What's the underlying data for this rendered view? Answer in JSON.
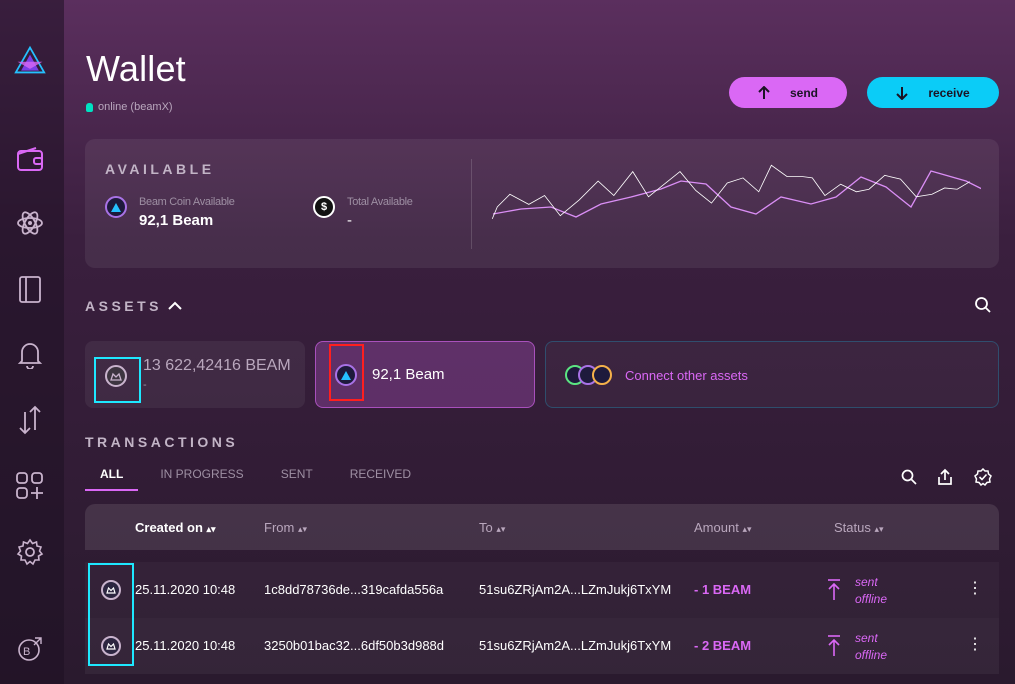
{
  "header": {
    "title": "Wallet",
    "status": "online (beamX)"
  },
  "actions": {
    "send": "send",
    "receive": "receive"
  },
  "available": {
    "label": "AVAILABLE",
    "beam_label": "Beam Coin Available",
    "beam_value": "92,1 Beam",
    "total_label": "Total Available",
    "total_value": "-",
    "total_icon": "$"
  },
  "assets": {
    "label": "ASSETS",
    "items": [
      {
        "value": "13 622,42416 BEAM",
        "sub": "-"
      },
      {
        "value": "92,1 Beam"
      },
      {
        "value": "Connect other assets"
      }
    ]
  },
  "transactions": {
    "label": "TRANSACTIONS",
    "tabs": [
      "ALL",
      "IN PROGRESS",
      "SENT",
      "RECEIVED"
    ],
    "columns": [
      "Created on",
      "From",
      "To",
      "Amount",
      "Status"
    ],
    "rows": [
      {
        "created": "25.11.2020 10:48",
        "from": "1c8dd78736de...319cafda556a",
        "to": "51su6ZRjAm2A...LZmJukj6TxYM",
        "amount": "- 1 BEAM",
        "status1": "sent",
        "status2": "offline"
      },
      {
        "created": "25.11.2020 10:48",
        "from": "3250b01bac32...6df50b3d988d",
        "to": "51su6ZRjAm2A...LZmJukj6TxYM",
        "amount": "- 2 BEAM",
        "status1": "sent",
        "status2": "offline"
      }
    ]
  },
  "sidebar": {
    "icons": [
      "beam-logo-icon",
      "wallet-icon",
      "atom-icon",
      "notebook-icon",
      "bell-icon",
      "swap-icon",
      "apps-icon",
      "settings-icon",
      "beamx-icon"
    ]
  },
  "colors": {
    "send": "#da68f5",
    "receive": "#0bccf7",
    "accent_pink": "#da68f5",
    "accent_cyan": "#0bccf7"
  }
}
